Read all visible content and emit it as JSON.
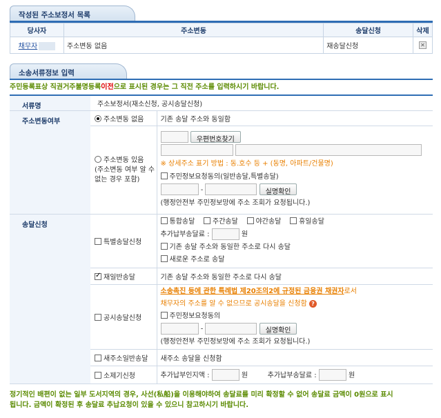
{
  "list_section": {
    "title": "작성된 주소보정서 목록",
    "headers": [
      "당사자",
      "주소변동",
      "송달신청",
      "삭제"
    ],
    "row": {
      "party": "채무자",
      "address_change": "주소변동 없음",
      "delivery": "재송달신청"
    }
  },
  "input_section": {
    "title": "소송서류정보 입력",
    "notice_pre": "주민등록표상 직권거주불명등록",
    "notice_red": "이전",
    "notice_post": "으로 표시된 경우는 그 직전 주소를 입력하시기 바랍니다."
  },
  "form": {
    "doc_name": {
      "label": "서류명",
      "value": "주소보정서(재소신청, 공시송달신청)"
    },
    "addr_change": {
      "label": "주소변동여부",
      "opt_none": "주소변동 없음",
      "opt_none_desc": "기존 송달 주소와 동일함",
      "opt_yes": "주소변동 있음",
      "opt_yes_sub": "(주소변동 여부 알 수 없는 경우 포함)",
      "postcode_btn": "우편번호찾기",
      "addr_hint": "※ 상세주소 표기 방법 : 동.호수 등 + (동명, 아파트/건물명)",
      "consent": "주민정보요청동의(일반송달,특별송달)",
      "dash": "-",
      "verify_btn": "실명확인",
      "lookup_note": "(행정안전부 주민정보망에 주소 조회가 요청됩니다.)"
    },
    "delivery": {
      "label": "송달신청",
      "special": {
        "label": "특별송달신청",
        "opt_integrated": "통합송달",
        "opt_day": "주간송달",
        "opt_night": "야간송달",
        "opt_holiday": "휴일송달",
        "fee_label": "추가납부송달료 :",
        "won": "원",
        "same_addr": "기존 송달 주소와 동일한 주소로 다시 송달",
        "new_addr": "새로운 주소로 송달"
      },
      "redelivery": {
        "label": "재일반송달",
        "desc": "기존 송달 주소와 동일한 주소로 다시 송달"
      },
      "public": {
        "label": "공시송달신청",
        "law_link": "소송촉진 등에 관한 특례법 제20조의2에 규정된 금융권 채권자",
        "law_post": "로서",
        "desc": "채무자의 주소를 알 수 없으므로 공시송달을 신청함",
        "consent": "주민정보요청동의",
        "dash": "-",
        "verify_btn": "실명확인",
        "lookup_note": "(행정안전부 주민정보망에 주소 조회가 요청됩니다.)"
      },
      "new_general": {
        "label": "새주소일반송달",
        "desc": "새주소 송달을 신청함"
      },
      "withdraw": {
        "label": "소제기신청",
        "stamp_label": "추가납부인지액 :",
        "fee_label": "추가납부송달료 :",
        "won": "원"
      }
    }
  },
  "footer": {
    "line1": "정기적인 배편이 없는 일부 도서지역의 경우, 사선(私船)을 이용해야하여 송달료를 미리 확정할 수 없어 송달료 금액이 0원으로 표시",
    "line2": "됩니다. 금액이 확정된 후 송달료 추납요청이 있을 수 있으니 참고하시기 바랍니다."
  }
}
